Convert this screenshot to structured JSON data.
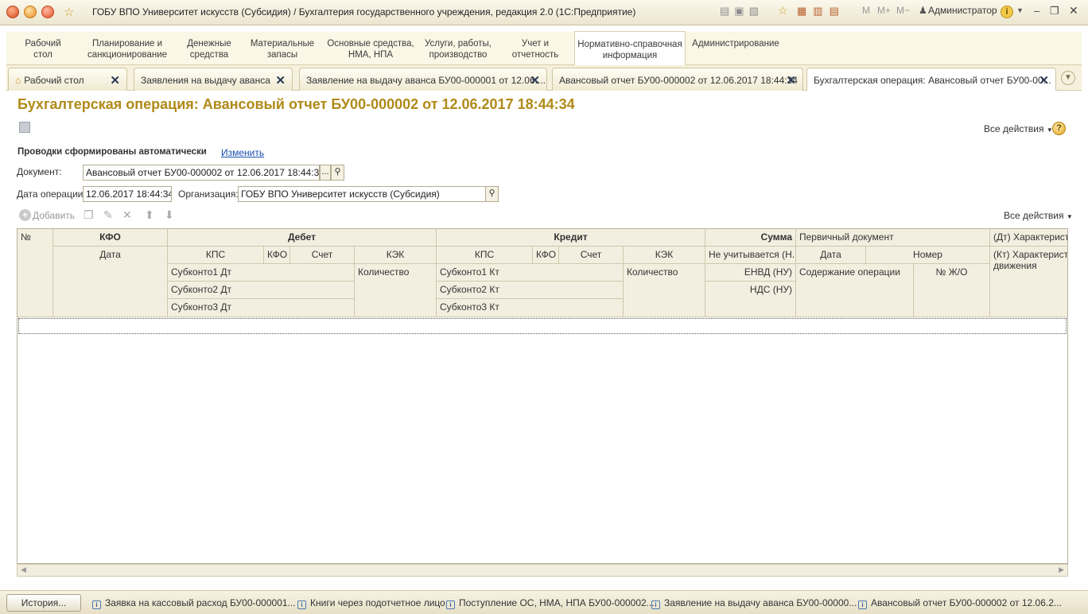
{
  "window": {
    "title": "ГОБУ ВПО Университет искусств (Субсидия) / Бухгалтерия государственного учреждения, редакция 2.0  (1С:Предприятие)",
    "mem_buttons": [
      "M",
      "M+",
      "M−"
    ],
    "user": "Администратор"
  },
  "sections": [
    {
      "label": "Рабочий\nстол"
    },
    {
      "label": "Планирование и\nсанкционирование"
    },
    {
      "label": "Денежные\nсредства"
    },
    {
      "label": "Материальные\nзапасы"
    },
    {
      "label": "Основные средства,\nНМА, НПА"
    },
    {
      "label": "Услуги, работы,\nпроизводство"
    },
    {
      "label": "Учет и\nотчетность"
    },
    {
      "label": "Нормативно-справочная\nинформация"
    },
    {
      "label": "Администрирование"
    }
  ],
  "tabs": [
    {
      "label": "Рабочий стол"
    },
    {
      "label": "Заявления на выдачу аванса"
    },
    {
      "label": "Заявление на выдачу аванса БУ00-000001 от 12.06...."
    },
    {
      "label": "Авансовый отчет БУ00-000002 от 12.06.2017 18:44:34"
    },
    {
      "label": "Бухгалтерская операция: Авансовый отчет БУ00-00..."
    }
  ],
  "form": {
    "title": "Бухгалтерская операция: Авансовый отчет БУ00-000002 от 12.06.2017 18:44:34",
    "all_actions": "Все действия",
    "help": "?",
    "auto_label": "Проводки сформированы автоматически",
    "change_link": "Изменить",
    "document_label": "Документ:",
    "document_value": "Авансовый отчет БУ00-000002 от 12.06.2017 18:44:34",
    "dots": "...",
    "date_label": "Дата операции:",
    "date_value": "12.06.2017 18:44:34",
    "org_label": "Организация:",
    "org_value": "ГОБУ ВПО Университет искусств (Субсидия)"
  },
  "toolbar": {
    "add": "Добавить",
    "all_actions": "Все действия"
  },
  "grid": {
    "h_num": "№",
    "h_kfo": "КФО",
    "h_debet": "Дебет",
    "h_kredit": "Кредит",
    "h_summa": "Сумма",
    "h_primary": "Первичный документ",
    "h_dt_char": "(Дт) Характеристи",
    "h_date": "Дата",
    "d_kps": "КПС",
    "d_kfo": "КФО",
    "d_schet": "Счет",
    "d_kek": "КЭК",
    "k_kps": "КПС",
    "k_kfo": "КФО",
    "k_schet": "Счет",
    "k_kek": "КЭК",
    "not_counted": "Не учитывается (Н...",
    "p_date": "Дата",
    "p_number": "Номер",
    "h_kt_char": "(Кт) Характеристи",
    "h_movement": "движения",
    "sub1_dt": "Субконто1 Дт",
    "qty_dt": "Количество",
    "sub1_kt": "Субконто1 Кт",
    "qty_kt": "Количество",
    "envd": "ЕНВД (НУ)",
    "content": "Содержание операции",
    "jo": "№ Ж/О",
    "sub2_dt": "Субконто2 Дт",
    "sub2_kt": "Субконто2 Кт",
    "nds": "НДС (НУ)",
    "sub3_dt": "Субконто3 Дт",
    "sub3_kt": "Субконто3 Кт"
  },
  "taskbar": {
    "history": "История...",
    "items": [
      "Заявка на кассовый расход БУ00-000001...",
      "Книги через подотчетное лицо",
      "Поступление ОС, НМА, НПА БУ00-000002...",
      "Заявление на выдачу аванса БУ00-00000...",
      "Авансовый отчет БУ00-000002 от 12.06.2..."
    ]
  }
}
